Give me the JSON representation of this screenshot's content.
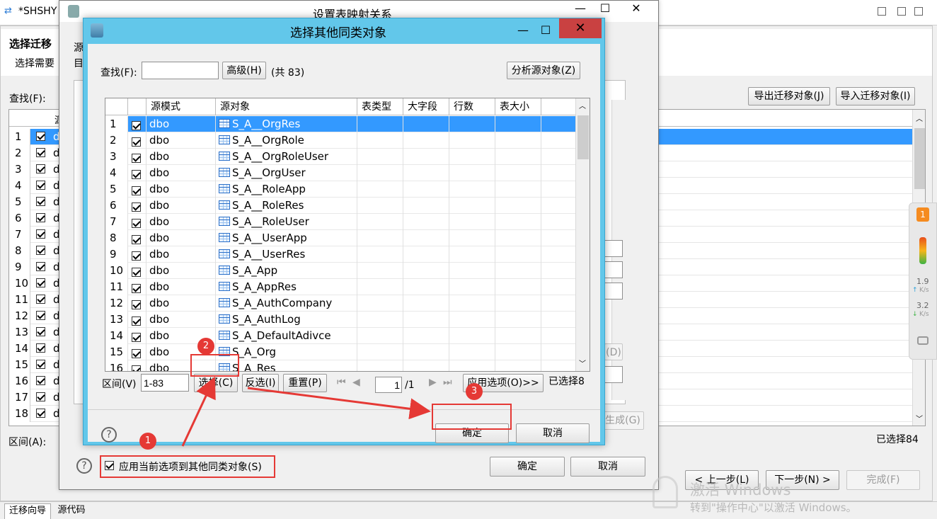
{
  "editor": {
    "tab_title": "*SHSHY",
    "heading": "选择迁移",
    "sub": "选择需要",
    "find_label": "查找(F):",
    "export_btn": "导出迁移对象(J)",
    "import_btn": "导入迁移对象(I)",
    "range_label": "区间(A):",
    "selected_count": "已选择84",
    "prev_btn": "< 上一步(L)",
    "next_btn": "下一步(N) >",
    "finish_btn": "完成(F)",
    "bottom_tabs": [
      "迁移向导",
      "源代码"
    ],
    "row_numbers": [
      "1",
      "2",
      "3",
      "4",
      "5",
      "6",
      "7",
      "8",
      "9",
      "10",
      "11",
      "12",
      "13",
      "14",
      "15",
      "16",
      "17",
      "18"
    ],
    "col_head": "源",
    "row_prefix": "d",
    "row_first": "d"
  },
  "outer_dialog": {
    "title": "设置表映射关系",
    "src_label": "源",
    "tgt_label": "目",
    "gen_btn": "生成(G)",
    "d_btn": "(D)",
    "apply_checkbox_label": "应用当前选项到其他同类对象(S)",
    "ok_btn": "确定",
    "cancel_btn": "取消"
  },
  "dialog": {
    "title": "选择其他同类对象",
    "find_label": "查找(F):",
    "find_value": "",
    "advanced_btn": "高级(H)",
    "total": "(共 83)",
    "analyze_btn": "分析源对象(Z)",
    "columns": [
      "源模式",
      "源对象",
      "表类型",
      "大字段",
      "行数",
      "表大小"
    ],
    "rows": [
      {
        "n": "1",
        "schema": "dbo",
        "object": "S_A__OrgRes"
      },
      {
        "n": "2",
        "schema": "dbo",
        "object": "S_A__OrgRole"
      },
      {
        "n": "3",
        "schema": "dbo",
        "object": "S_A__OrgRoleUser"
      },
      {
        "n": "4",
        "schema": "dbo",
        "object": "S_A__OrgUser"
      },
      {
        "n": "5",
        "schema": "dbo",
        "object": "S_A__RoleApp"
      },
      {
        "n": "6",
        "schema": "dbo",
        "object": "S_A__RoleRes"
      },
      {
        "n": "7",
        "schema": "dbo",
        "object": "S_A__RoleUser"
      },
      {
        "n": "8",
        "schema": "dbo",
        "object": "S_A__UserApp"
      },
      {
        "n": "9",
        "schema": "dbo",
        "object": "S_A__UserRes"
      },
      {
        "n": "10",
        "schema": "dbo",
        "object": "S_A_App"
      },
      {
        "n": "11",
        "schema": "dbo",
        "object": "S_A_AppRes"
      },
      {
        "n": "12",
        "schema": "dbo",
        "object": "S_A_AuthCompany"
      },
      {
        "n": "13",
        "schema": "dbo",
        "object": "S_A_AuthLog"
      },
      {
        "n": "14",
        "schema": "dbo",
        "object": "S_A_DefaultAdivce"
      },
      {
        "n": "15",
        "schema": "dbo",
        "object": "S_A_Org"
      },
      {
        "n": "16",
        "schema": "dbo",
        "object": "S_A_Res"
      }
    ],
    "range_label": "区间(V)",
    "range_value": "1-83",
    "select_btn": "选择(C)",
    "invert_btn": "反选(I)",
    "reset_btn": "重置(P)",
    "page_value": "1",
    "page_total": "/1",
    "apply_options_btn": "应用选项(O)>>",
    "selected_count": "已选择8",
    "ok_btn": "确定",
    "cancel_btn": "取消",
    "help": "?"
  },
  "annotations": {
    "badge1": "1",
    "badge2": "2",
    "badge3": "3"
  },
  "watermark": {
    "line1": "激活 Windows",
    "line2": "转到\"操作中心\"以激活 Windows。"
  },
  "side_widget": {
    "badge": "1",
    "up_speed": "1.9",
    "up_unit": "K/s",
    "down_speed": "3.2",
    "down_unit": "K/s"
  },
  "colors": {
    "title_bar": "#62c7ea",
    "selection": "#3399ff",
    "close_red": "#c94141",
    "annotation": "#e53935"
  }
}
